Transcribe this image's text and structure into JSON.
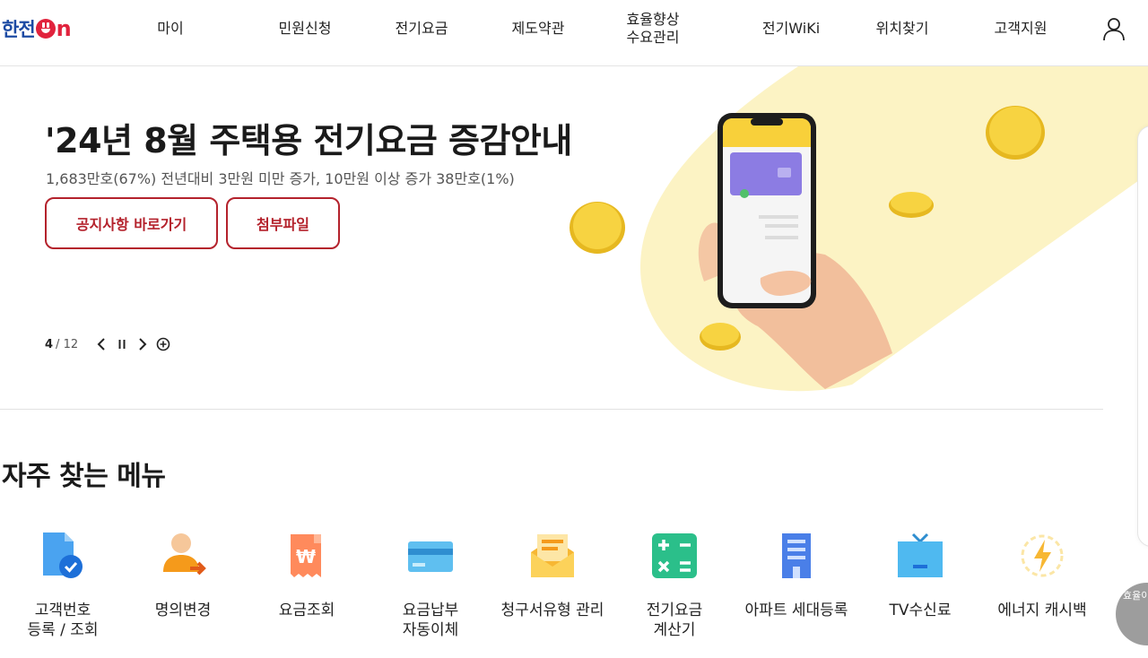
{
  "header": {
    "logo_text": "한전",
    "logo_on": "n",
    "nav": [
      "마이",
      "민원신청",
      "전기요금",
      "제도약관",
      "효율향상\n수요관리",
      "전기WiKi",
      "위치찾기",
      "고객지원"
    ]
  },
  "hero": {
    "title": "'24년 8월 주택용 전기요금 증감안내",
    "subtitle": "1,683만호(67%) 전년대비 3만원 미만 증가, 10만원 이상 증가 38만호(1%)",
    "buttons": [
      "공지사항 바로가기",
      "첨부파일"
    ],
    "pager": {
      "current": "4",
      "total": "12"
    }
  },
  "frequent_menu": {
    "title": "자주 찾는 메뉴",
    "items": [
      {
        "label": "고객번호\n등록 / 조회",
        "icon": "customer-number-doc-icon"
      },
      {
        "label": "명의변경",
        "icon": "owner-change-person-icon"
      },
      {
        "label": "요금조회",
        "icon": "bill-receipt-won-icon"
      },
      {
        "label": "요금납부\n자동이체",
        "icon": "credit-card-icon"
      },
      {
        "label": "청구서유형 관리",
        "icon": "envelope-letter-icon"
      },
      {
        "label": "전기요금\n계산기",
        "icon": "calculator-icon"
      },
      {
        "label": "아파트 세대등록",
        "icon": "apartment-building-icon"
      },
      {
        "label": "TV수신료",
        "icon": "television-icon"
      },
      {
        "label": "에너지 캐시백",
        "icon": "energy-lightning-icon"
      }
    ]
  },
  "floating_button": {
    "label": "효율이"
  },
  "colors": {
    "brand_blue": "#1c4aa3",
    "brand_red": "#e1233d",
    "button_red": "#b4222c",
    "hero_yellow": "#fcf3c4"
  }
}
